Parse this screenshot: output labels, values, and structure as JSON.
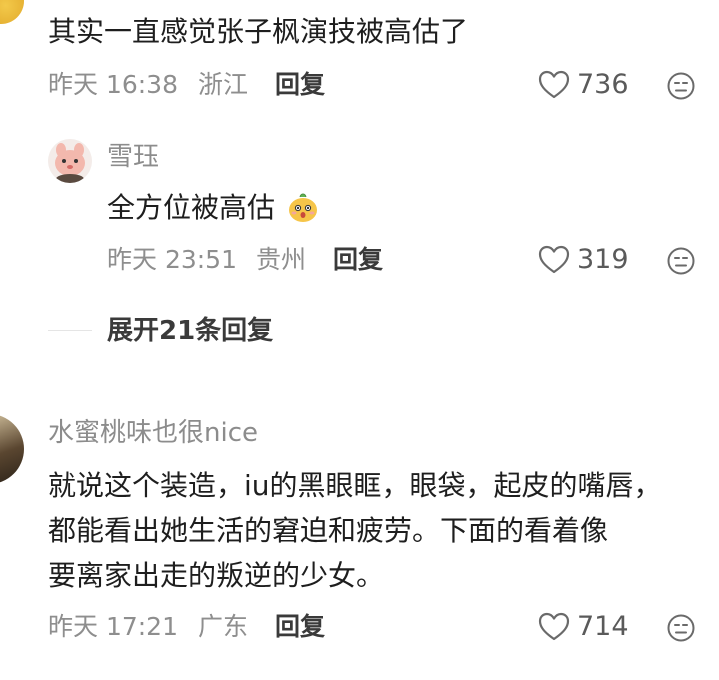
{
  "comments": [
    {
      "text_lines": [
        "其实一直感觉张子枫演技被高估了"
      ],
      "time": "昨天 16:38",
      "location": "浙江",
      "reply_label": "回复",
      "likes": "736",
      "avatar_icon": "yellow-avatar-icon"
    },
    {
      "username": "雪珏",
      "text_lines": [
        "全方位被高估"
      ],
      "emoji_icon": "surprised-face-emoji-icon",
      "time": "昨天 23:51",
      "location": "贵州",
      "reply_label": "回复",
      "likes": "319",
      "avatar_icon": "pink-bunny-avatar-icon"
    },
    {
      "username": "水蜜桃味也很nice",
      "text_lines": [
        "就说这个装造，iu的黑眼眶，眼袋，起皮的嘴唇，",
        "都能看出她生活的窘迫和疲劳。下面的看着像",
        "要离家出走的叛逆的少女。"
      ],
      "time": "昨天 17:21",
      "location": "广东",
      "reply_label": "回复",
      "likes": "714",
      "avatar_icon": "dark-photo-avatar-icon"
    }
  ],
  "expand_replies": "展开21条回复",
  "colors": {
    "text": "#1e1e1e",
    "meta": "#8e8e8e",
    "icon": "#6a6a6a"
  }
}
